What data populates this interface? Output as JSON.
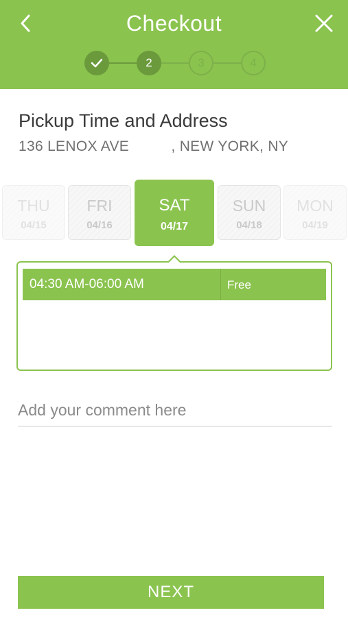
{
  "header": {
    "title": "Checkout",
    "back_icon": "chevron-left-icon",
    "close_icon": "close-icon",
    "bg_color": "#8bc34f"
  },
  "stepper": {
    "steps": [
      {
        "label": "✓",
        "state": "done"
      },
      {
        "label": "2",
        "state": "active"
      },
      {
        "label": "3",
        "state": "future"
      },
      {
        "label": "4",
        "state": "future"
      }
    ]
  },
  "pickup": {
    "title": "Pickup Time and Address",
    "address": "136 LENOX AVE          , NEW YORK, NY"
  },
  "days": [
    {
      "name": "THU",
      "date": "04/15"
    },
    {
      "name": "FRI",
      "date": "04/16"
    },
    {
      "name": "SAT",
      "date": "04/17",
      "selected": true
    },
    {
      "name": "SUN",
      "date": "04/18"
    },
    {
      "name": "MON",
      "date": "04/19"
    }
  ],
  "slots": [
    {
      "time": "04:30 AM-06:00 AM",
      "price": "Free"
    }
  ],
  "comment": {
    "placeholder": "Add your comment here",
    "value": ""
  },
  "next_button": {
    "label": "NEXT"
  },
  "colors": {
    "accent": "#8bc34f",
    "step_dark": "#6a9a3c"
  }
}
